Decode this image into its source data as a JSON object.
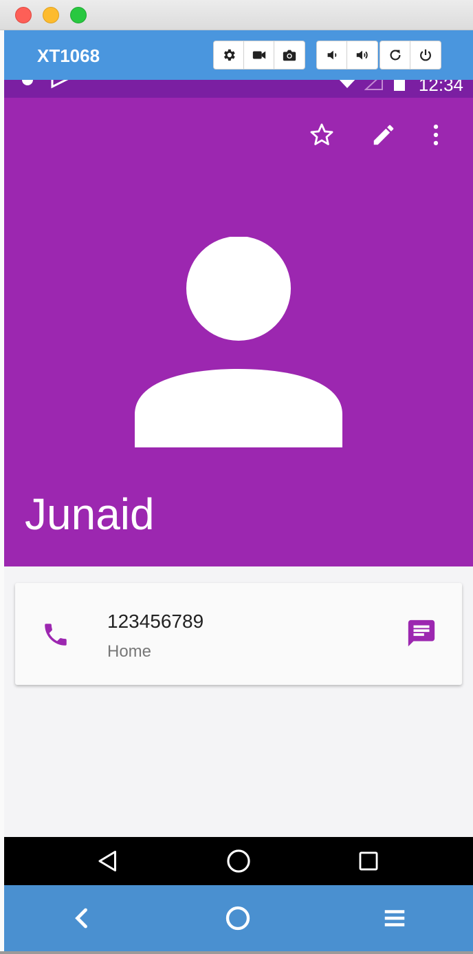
{
  "toolbar": {
    "device_name": "XT1068",
    "buttons": [
      "settings-icon",
      "video-icon",
      "camera-icon",
      "volume-down-icon",
      "volume-up-icon",
      "rotate-icon",
      "power-icon"
    ]
  },
  "status_bar": {
    "time": "12:34"
  },
  "contact": {
    "name": "Junaid",
    "phone_number": "123456789",
    "phone_type": "Home"
  },
  "header_actions": [
    "star-icon",
    "edit-icon",
    "more-vert-icon"
  ],
  "android_nav": [
    "back-icon",
    "home-icon",
    "recents-icon"
  ],
  "emulator_nav": [
    "chevron-left-icon",
    "circle-icon",
    "menu-icon"
  ],
  "colors": {
    "header": "#9c27b0",
    "status_bar": "#7b1fa2",
    "toolbar": "#4a96de",
    "accent": "#9c27b0"
  }
}
